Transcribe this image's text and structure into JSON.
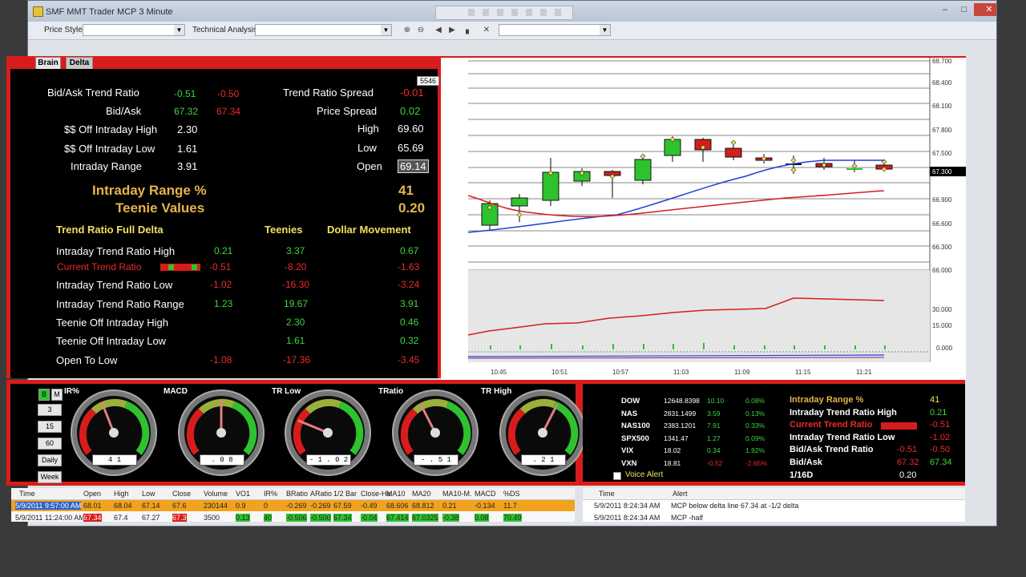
{
  "window": {
    "title": "SMF MMT Trader MCP  3 Minute"
  },
  "toolbar": {
    "price_style": "Price Style",
    "technical_analysis": "Technical Analysis"
  },
  "tabs": [
    {
      "label": "Brain"
    },
    {
      "label": "Delta"
    }
  ],
  "brain": {
    "box_value": "5546",
    "rows": [
      {
        "label": "Bid/Ask Trend Ratio",
        "v1": "-0.51",
        "v2": "-0.50"
      },
      {
        "label": "Bid/Ask",
        "v1": "67.32",
        "v2": "67.34"
      },
      {
        "label": "$$ Off Intraday High",
        "v1": "2.30"
      },
      {
        "label": "$$ Off Intraday Low",
        "v1": "1.61"
      },
      {
        "label": "Intraday Range",
        "v1": "3.91"
      }
    ],
    "right_rows": [
      {
        "label": "Trend Ratio Spread",
        "value": "-0.01"
      },
      {
        "label": "Price Spread",
        "value": "0.02"
      },
      {
        "label": "High",
        "value": "69.60"
      },
      {
        "label": "Low",
        "value": "65.69"
      },
      {
        "label": "Open",
        "value": "69.14"
      }
    ],
    "range_pct_label": "Intraday Range %",
    "range_pct_value": "41",
    "teenie_label": "Teenie Values",
    "teenie_value": "0.20",
    "headers": {
      "trend": "Trend Ratio Full Delta",
      "teenies": "Teenies",
      "dollar": "Dollar Movement"
    },
    "delta_rows": [
      {
        "label": "Intraday Trend Ratio High",
        "trend": "0.21",
        "teenies": "3.37",
        "dollar": "0.67"
      },
      {
        "label": "Current Trend Ratio",
        "trend": "-0.51",
        "teenies": "-8.20",
        "dollar": "-1.63"
      },
      {
        "label": "Intraday Trend Ratio Low",
        "trend": "-1.02",
        "teenies": "-16.30",
        "dollar": "-3.24"
      },
      {
        "label": "Intraday Trend Ratio Range",
        "trend": "1.23",
        "teenies": "19.67",
        "dollar": "3.91"
      },
      {
        "label": "Teenie Off Intraday High",
        "trend": "",
        "teenies": "2.30",
        "dollar": "0.46"
      },
      {
        "label": "Teenie Off Intraday Low",
        "trend": "",
        "teenies": "1.61",
        "dollar": "0.32"
      },
      {
        "label": "Open To Low",
        "trend": "-1.08",
        "teenies": "-17.36",
        "dollar": "-3.45"
      }
    ]
  },
  "chart": {
    "y_ticks": [
      "68.700",
      "68.400",
      "68.100",
      "67.800",
      "67.500",
      "67.300",
      "66.900",
      "66.600",
      "66.300",
      "66.000"
    ],
    "current_price": "67.300",
    "lower_ticks": [
      "30.000",
      "15.000",
      "0.000"
    ],
    "x_ticks": [
      "10:45",
      "10:51",
      "10:57",
      "11:03",
      "11:09",
      "11:15",
      "11:21"
    ]
  },
  "gauges": {
    "side_buttons": [
      "B",
      "M",
      "3",
      "15",
      "60",
      "Daily",
      "Week"
    ],
    "items": [
      {
        "label": "IR%",
        "readout": "4 1",
        "needle": 0.42
      },
      {
        "label": "MACD",
        "readout": ". 0 8",
        "needle": 0.5
      },
      {
        "label": "TR Low",
        "readout": "- 1 . 0 2",
        "needle": 0.25
      },
      {
        "label": "TRatio",
        "readout": "- . 5 1",
        "needle": 0.4
      },
      {
        "label": "TR High",
        "readout": ". 2 1",
        "needle": 0.6
      }
    ],
    "plus_button": "+"
  },
  "market": {
    "rows": [
      {
        "sym": "DOW",
        "price": "12648.8398",
        "chg": "10.10",
        "pct": "0.08%"
      },
      {
        "sym": "NAS",
        "price": "2831.1499",
        "chg": "3.59",
        "pct": "0.13%"
      },
      {
        "sym": "NAS100",
        "price": "2383.1201",
        "chg": "7.91",
        "pct": "0.33%"
      },
      {
        "sym": "SPX500",
        "price": "1341.47",
        "chg": "1.27",
        "pct": "0.09%"
      },
      {
        "sym": "VIX",
        "price": "18.02",
        "chg": "0.34",
        "pct": "1.92%"
      },
      {
        "sym": "VXN",
        "price": "18.81",
        "chg": "-0.52",
        "pct": "-2.65%"
      }
    ],
    "voice_alert": "Voice Alert",
    "summary": [
      {
        "label": "Intraday Range %",
        "v1": "",
        "v2": "41"
      },
      {
        "label": "Intraday Trend Ratio High",
        "v1": "",
        "v2": "0.21"
      },
      {
        "label": "Current Trend Ratio",
        "v1": "",
        "v2": "-0.51"
      },
      {
        "label": "Intraday Trend Ratio Low",
        "v1": "",
        "v2": "-1.02"
      },
      {
        "label": "Bid/Ask Trend Ratio",
        "v1": "-0.51",
        "v2": "-0.50"
      },
      {
        "label": "Bid/Ask",
        "v1": "67.32",
        "v2": "67.34"
      },
      {
        "label": "1/16D",
        "v1": "0.20",
        "v2": ""
      }
    ]
  },
  "data_grid": {
    "columns": [
      "Time",
      "Open",
      "High",
      "Low",
      "Close",
      "Volume",
      "VO1",
      "IR%",
      "BRatio",
      "ARatio",
      "1/2 Bar",
      "Close-Ha",
      "MA10",
      "MA20",
      "MA10-M.",
      "MACD",
      "%DS"
    ],
    "rows": [
      [
        "5/9/2011 9:57:00 AM",
        "68.01",
        "68.04",
        "67.14",
        "67.6",
        "230144",
        "0.9",
        "0",
        "-0.269",
        "-0.269",
        "67.59",
        "-0.49",
        "68.606",
        "68.812",
        "0.21",
        "-0.134",
        "11.7"
      ],
      [
        "5/9/2011 11:24:00 AM",
        "67.34",
        "67.4",
        "67.27",
        "67.3",
        "3500",
        "0.13",
        "40",
        "-0.506",
        "-0.500",
        "67.34",
        "-0.04",
        "67.414",
        "67.0325",
        "-0.38",
        "0.08",
        "70.49"
      ]
    ]
  },
  "alerts": {
    "columns": [
      "Time",
      "Alert"
    ],
    "rows": [
      {
        "time": "5/9/2011 8:24:34 AM",
        "text": "MCP below delta line 67.34 at -1/2 delta"
      },
      {
        "time": "5/9/2011 8:24:34 AM",
        "text": "MCP -half"
      }
    ]
  },
  "colors": {
    "panel_red": "#d81c1c",
    "up": "#2ec22e",
    "down": "#d11f1f",
    "ma_blue": "#1f3fd6",
    "ma_red": "#d81c1c"
  }
}
